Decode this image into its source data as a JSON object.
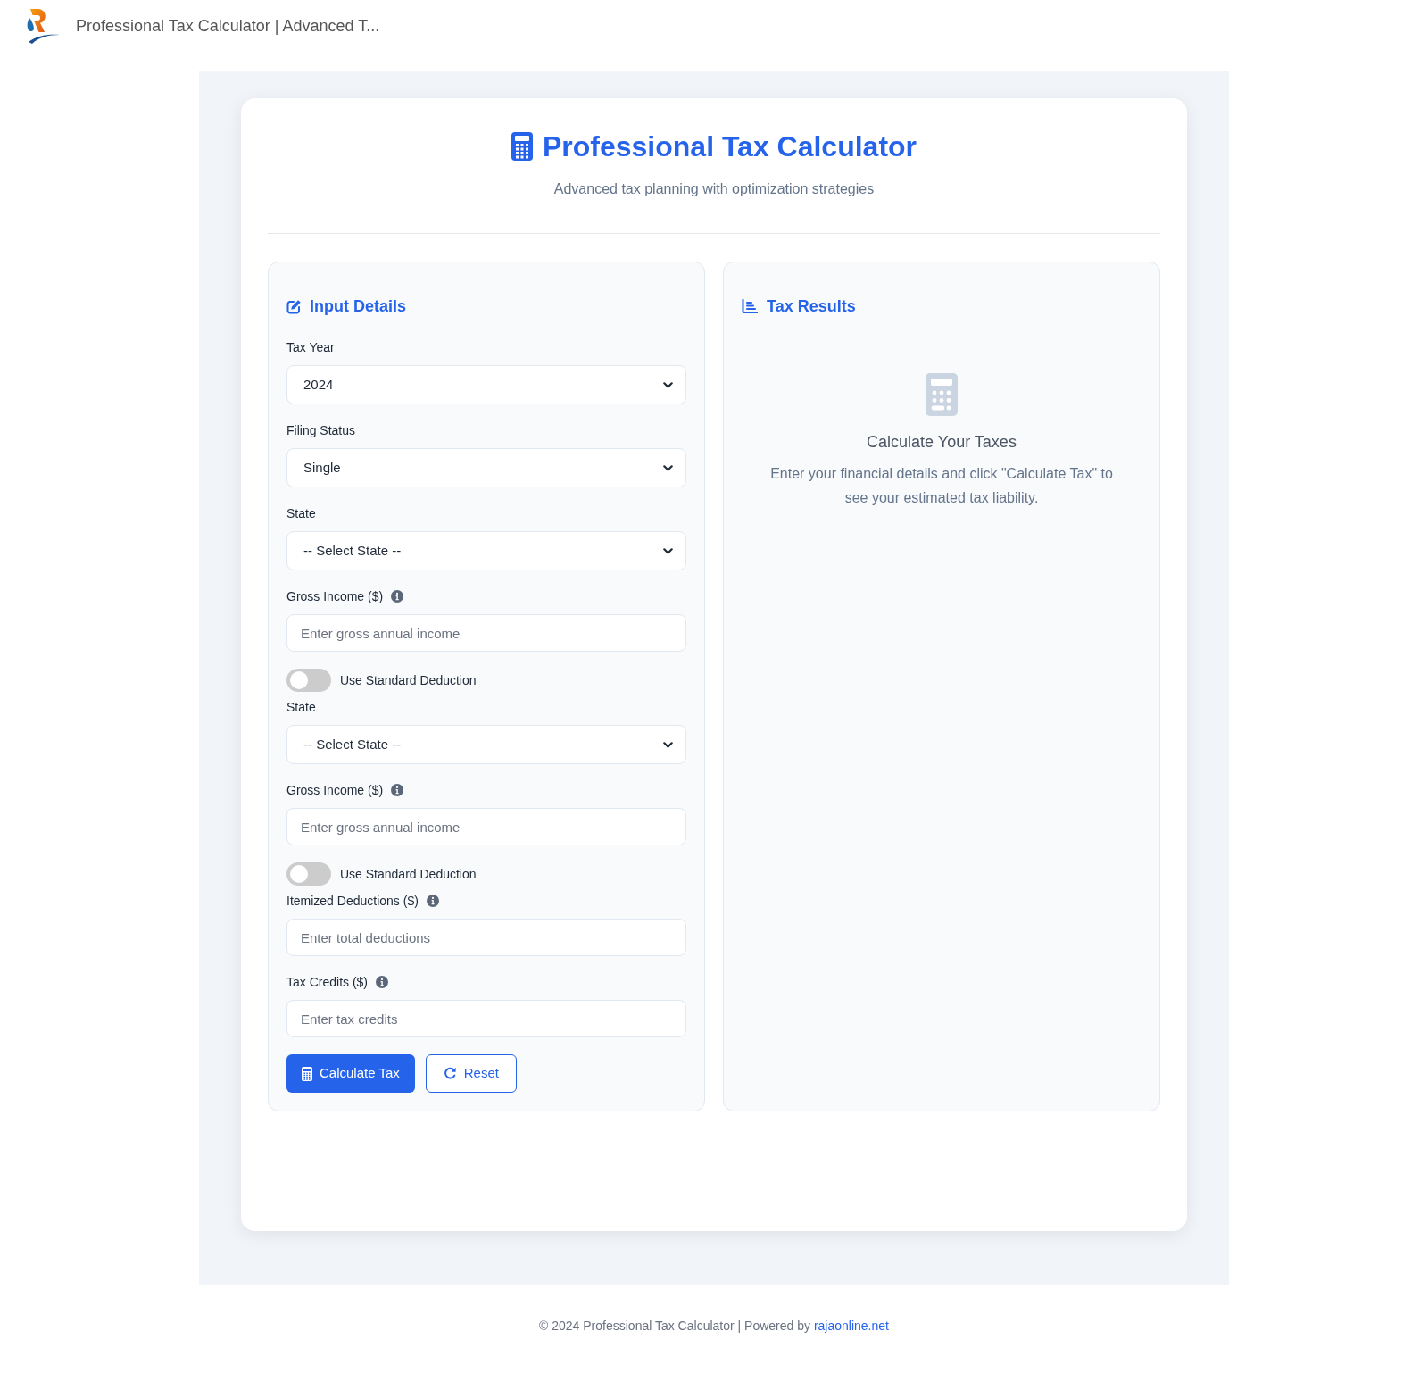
{
  "header": {
    "title": "Professional Tax Calculator | Advanced T..."
  },
  "card": {
    "title": "Professional Tax Calculator",
    "subtitle": "Advanced tax planning with optimization strategies"
  },
  "input_panel": {
    "heading": "Input Details",
    "fields": [
      {
        "kind": "select",
        "label": "Tax Year",
        "value": "2024"
      },
      {
        "kind": "select",
        "label": "Filing Status",
        "value": "Single"
      },
      {
        "kind": "select",
        "label": "State",
        "value": "-- Select State --"
      },
      {
        "kind": "input",
        "label": "Gross Income ($)",
        "info": true,
        "placeholder": "Enter gross annual income"
      },
      {
        "kind": "toggle",
        "label": "Use Standard Deduction",
        "on": false
      },
      {
        "kind": "select",
        "label": "State",
        "value": "-- Select State --"
      },
      {
        "kind": "input",
        "label": "Gross Income ($)",
        "info": true,
        "placeholder": "Enter gross annual income"
      },
      {
        "kind": "toggle",
        "label": "Use Standard Deduction",
        "on": false
      },
      {
        "kind": "input",
        "label": "Itemized Deductions ($)",
        "info": true,
        "placeholder": "Enter total deductions"
      },
      {
        "kind": "input",
        "label": "Tax Credits ($)",
        "info": true,
        "placeholder": "Enter tax credits"
      }
    ],
    "buttons": [
      {
        "kind": "primary",
        "label": "Calculate Tax"
      },
      {
        "kind": "secondary",
        "label": "Reset"
      }
    ]
  },
  "results_panel": {
    "heading": "Tax Results",
    "empty_title": "Calculate Your Taxes",
    "empty_text": "Enter your financial details and click \"Calculate Tax\" to see your estimated tax liability."
  },
  "footer": {
    "text": "© 2024 Professional Tax Calculator | Powered by",
    "link": "rajaonline.net"
  }
}
